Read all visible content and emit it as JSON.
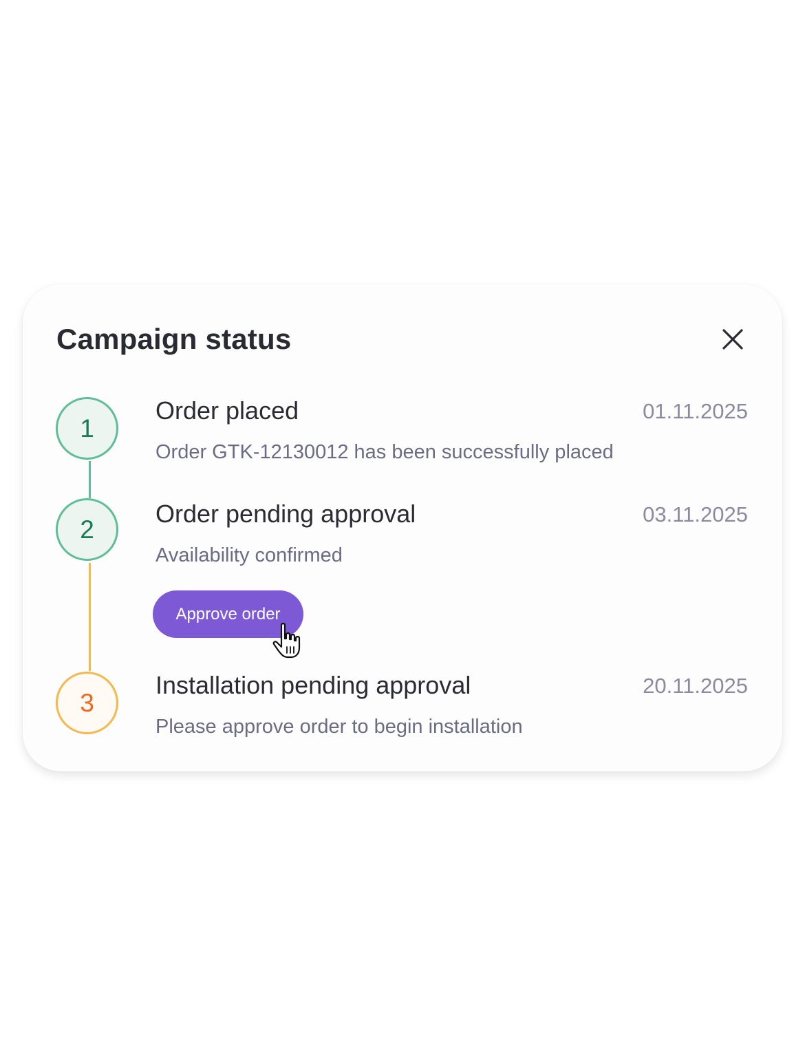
{
  "dialog": {
    "title": "Campaign status",
    "close_icon": "close-icon"
  },
  "steps": [
    {
      "number": "1",
      "title": "Order placed",
      "date": "01.11.2025",
      "description": "Order GTK-12130012 has been successfully placed",
      "status": "complete"
    },
    {
      "number": "2",
      "title": "Order pending approval",
      "date": "03.11.2025",
      "description": "Availability confirmed",
      "status": "complete",
      "action_label": "Approve order"
    },
    {
      "number": "3",
      "title": "Installation pending approval",
      "date": "20.11.2025",
      "description": "Please approve order to begin installation",
      "status": "pending"
    }
  ],
  "colors": {
    "complete": "#5dbe97",
    "pending": "#f6b84d",
    "accent": "#7e59d6"
  },
  "cursor_icon": "hand-pointer-icon"
}
